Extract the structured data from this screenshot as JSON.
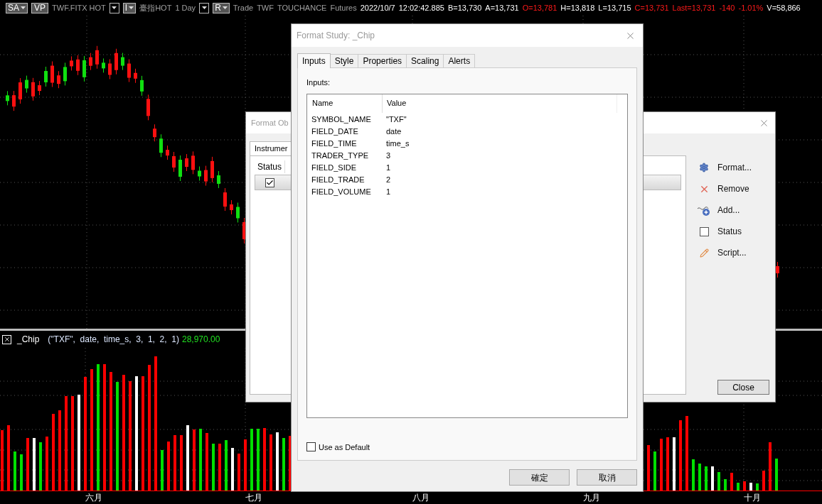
{
  "toolbar": {
    "items": [
      {
        "kind": "dropdown",
        "label": "SA"
      },
      {
        "kind": "button",
        "label": "VP"
      },
      {
        "kind": "label",
        "text": "TWF.FITX HOT",
        "color": "#a0a0a0"
      },
      {
        "kind": "menu"
      },
      {
        "kind": "dropdown",
        "label": "I"
      },
      {
        "kind": "label",
        "text": "臺指HOT",
        "color": "#a0a0a0"
      },
      {
        "kind": "label",
        "text": "1 Day",
        "color": "#a0a0a0"
      },
      {
        "kind": "menu"
      },
      {
        "kind": "dropdown",
        "label": "R"
      },
      {
        "kind": "label",
        "text": "Trade",
        "color": "#a0a0a0"
      },
      {
        "kind": "label",
        "text": "TWF",
        "color": "#a0a0a0"
      },
      {
        "kind": "label",
        "text": "TOUCHANCE",
        "color": "#a0a0a0"
      },
      {
        "kind": "label",
        "text": "Futures",
        "color": "#a0a0a0"
      },
      {
        "kind": "label",
        "text": "2022/10/7",
        "color": "#ffffff"
      },
      {
        "kind": "label",
        "text": "12:02:42.885",
        "color": "#ffffff"
      },
      {
        "kind": "label",
        "text": "B=13,730",
        "color": "#ffffff"
      },
      {
        "kind": "label",
        "text": "A=13,731",
        "color": "#ffffff"
      },
      {
        "kind": "label",
        "text": "O=13,781",
        "color": "#ff1a1a"
      },
      {
        "kind": "label",
        "text": "H=13,818",
        "color": "#ffffff"
      },
      {
        "kind": "label",
        "text": "L=13,715",
        "color": "#ffffff"
      },
      {
        "kind": "label",
        "text": "C=13,731",
        "color": "#ff1a1a"
      },
      {
        "kind": "label",
        "text": "Last=13,731",
        "color": "#ff1a1a"
      },
      {
        "kind": "label",
        "text": "-140",
        "color": "#ff1a1a"
      },
      {
        "kind": "label",
        "text": "-1.01%",
        "color": "#ff1a1a"
      },
      {
        "kind": "label",
        "text": "V=58,866",
        "color": "#ffffff"
      }
    ]
  },
  "indicator": {
    "name": "_Chip",
    "params": "(\"TXF\",  date,  time_s,  3,  1,  2,  1)",
    "value": "28,970.00"
  },
  "axis": {
    "months": [
      "六月",
      "七月",
      "八月",
      "九月",
      "十月"
    ]
  },
  "objects_dialog": {
    "title": "Format Ob",
    "tab": "Instrumer",
    "column": "Status",
    "row_checked": true,
    "actions": [
      {
        "kind": "gear",
        "label": "Format..."
      },
      {
        "kind": "remove",
        "label": "Remove"
      },
      {
        "kind": "add",
        "label": "Add..."
      },
      {
        "kind": "checkbox",
        "label": "Status",
        "checked": false
      },
      {
        "kind": "script",
        "label": "Script..."
      }
    ],
    "close_button": "Close"
  },
  "study_dialog": {
    "title": "Format Study: _Chip",
    "tabs": [
      {
        "label": "Inputs",
        "selected": true
      },
      {
        "label": "Style",
        "selected": false
      },
      {
        "label": "Properties",
        "selected": false
      },
      {
        "label": "Scaling",
        "selected": false
      },
      {
        "label": "Alerts",
        "selected": false
      }
    ],
    "inputs_label": "Inputs:",
    "columns": [
      "Name",
      "Value"
    ],
    "rows": [
      {
        "name": "SYMBOL_NAME",
        "value": "\"TXF\""
      },
      {
        "name": "FIELD_DATE",
        "value": "date"
      },
      {
        "name": "FIELD_TIME",
        "value": "time_s"
      },
      {
        "name": "TRADER_TYPE",
        "value": "3"
      },
      {
        "name": "FIELD_SIDE",
        "value": "1"
      },
      {
        "name": "FIELD_TRADE",
        "value": "2"
      },
      {
        "name": "FIELD_VOLUME",
        "value": "1"
      }
    ],
    "use_default": {
      "label": "Use as Default",
      "checked": false
    },
    "buttons": [
      "確定",
      "取消"
    ]
  }
}
